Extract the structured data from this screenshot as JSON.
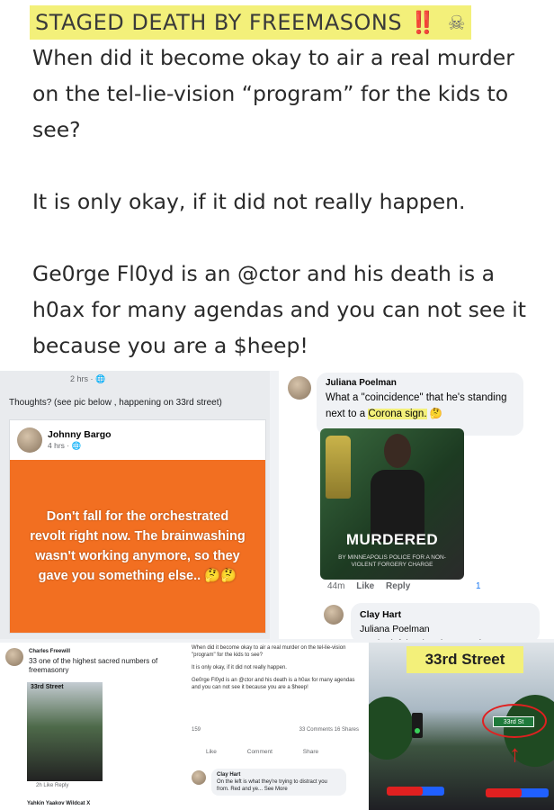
{
  "note": {
    "title": "STAGED DEATH BY FREEMASONS",
    "title_emphasis": "‼️",
    "title_icon": "skull-crossbones-icon",
    "paragraphs": [
      "When did it become okay to air a real murder on the tel-lie-vision “program” for the kids to see?",
      "It is only okay, if it did not really happen.",
      "Ge0rge Fl0yd is an @ctor and his death is a h0ax for many agendas and you can not see it because you are a $heep!"
    ]
  },
  "post_left": {
    "time": "2 hrs · 🌐",
    "text": "Thoughts? (see pic below , happening on 33rd street)",
    "shared": {
      "author": "Johnny Bargo",
      "time": "4 hrs · 🌐",
      "body": "Don't fall for the orchestrated revolt right now. The brainwashing wasn't working anymore, so they gave you something else.. 🤔🤔"
    }
  },
  "post_right": {
    "commenter": "Juliana Poelman",
    "comment_prefix": "What a \"coincidence\" that he's standing next to a ",
    "comment_highlight": "Corona sign.",
    "comment_emoji": "🤔",
    "photo_banner": "MURDERED",
    "photo_sub": "BY MINNEAPOLIS POLICE FOR A NON-VIOLENT FORGERY CHARGE",
    "time": "44m",
    "like": "Like",
    "reply": "Reply",
    "reaction_count": "1",
    "reply_author": "Clay Hart",
    "reply_text": "Juliana Poelman",
    "reply_cutoff": "On the left is what they're trying"
  },
  "screen_mini": {
    "author": "Charles Freewill",
    "text": "33 one of the highest sacred numbers of freemasonry",
    "thumb_label": "33rd Street",
    "footer": "2h   Like   Reply",
    "next_author": "Yahkin Yaakov Wildcat X"
  },
  "screen_mid": {
    "copy": [
      "When did it become okay to air a real murder on the tel-lie-vision \"program\" for the kids to see?",
      "It is only okay, if it did not really happen.",
      "Ge0rge Fl0yd is an @ctor and his death is a h0ax for many agendas and you can not see it because you are a $heep!"
    ],
    "reactions": "159",
    "comments_shares": "33 Comments  16 Shares",
    "actions": [
      "Like",
      "Comment",
      "Share"
    ],
    "reply_author": "Clay Hart",
    "reply_text": "On the left is what they're trying to distract you from. Red and ye... See More"
  },
  "street": {
    "sign": "33rd Street",
    "green_sign": "33rd St"
  }
}
